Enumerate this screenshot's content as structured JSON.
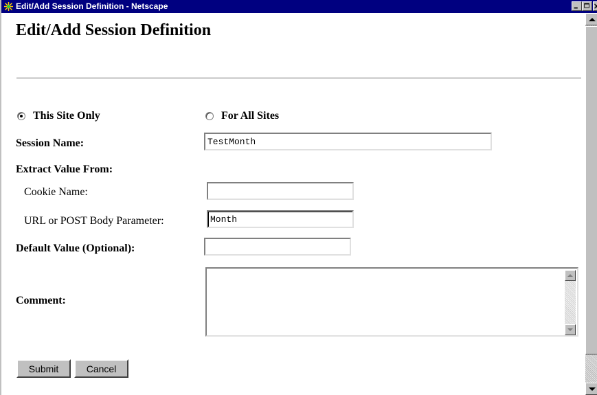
{
  "window": {
    "title": "Edit/Add Session Definition - Netscape"
  },
  "page": {
    "heading": "Edit/Add Session Definition"
  },
  "scope": {
    "this_site_label": "This Site Only",
    "all_sites_label": "For All Sites",
    "selected": "This Site Only"
  },
  "form": {
    "session_name_label": "Session Name:",
    "session_name_value": "TestMonth",
    "extract_label": "Extract Value From:",
    "cookie_label": "Cookie Name:",
    "cookie_value": "",
    "param_label": "URL or POST Body Parameter:",
    "param_value": "Month",
    "default_label": "Default Value (Optional):",
    "default_value": "",
    "comment_label": "Comment:",
    "comment_value": ""
  },
  "buttons": {
    "submit": "Submit",
    "cancel": "Cancel"
  },
  "colors": {
    "titlebar": "#000080",
    "chrome": "#c0c0c0",
    "background": "#ffffff"
  },
  "icons": {
    "app": "netscape-icon",
    "minimize": "minimize-icon",
    "maximize": "maximize-icon",
    "close": "close-icon"
  }
}
